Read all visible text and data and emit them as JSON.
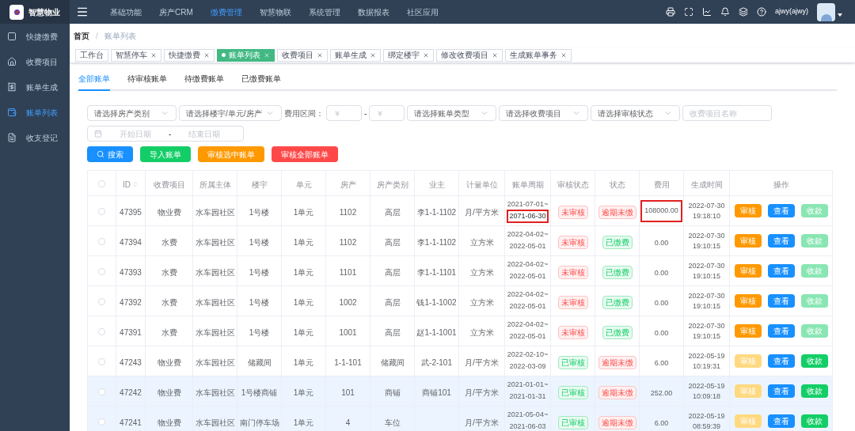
{
  "brand": {
    "name": "智慧物业"
  },
  "top_nav": [
    {
      "label": "基础功能",
      "selected": false
    },
    {
      "label": "房产CRM",
      "selected": false
    },
    {
      "label": "缴费管理",
      "selected": true
    },
    {
      "label": "智慧物联",
      "selected": false
    },
    {
      "label": "系统管理",
      "selected": false
    },
    {
      "label": "数据报表",
      "selected": false
    },
    {
      "label": "社区应用",
      "selected": false
    }
  ],
  "user": {
    "name": "ajwy(ajwy)"
  },
  "sidebar": {
    "items": [
      {
        "label": "快捷缴费",
        "selected": false
      },
      {
        "label": "收费项目",
        "selected": false
      },
      {
        "label": "账单生成",
        "selected": false
      },
      {
        "label": "账单列表",
        "selected": true
      },
      {
        "label": "收支登记",
        "selected": false
      }
    ]
  },
  "breadcrumb": {
    "items": [
      "首页",
      "账单列表"
    ],
    "separator": "/"
  },
  "page_tags": [
    {
      "label": "工作台",
      "closable": false,
      "selected": false
    },
    {
      "label": "智慧停车",
      "closable": true,
      "selected": false
    },
    {
      "label": "快捷缴费",
      "closable": true,
      "selected": false
    },
    {
      "label": "账单列表",
      "closable": true,
      "selected": true
    },
    {
      "label": "收费项目",
      "closable": true,
      "selected": false
    },
    {
      "label": "账单生成",
      "closable": true,
      "selected": false
    },
    {
      "label": "绑定楼宇",
      "closable": true,
      "selected": false
    },
    {
      "label": "修改收费项目",
      "closable": true,
      "selected": false
    },
    {
      "label": "生成账单事务",
      "closable": true,
      "selected": false
    }
  ],
  "tabs": [
    {
      "label": "全部账单",
      "selected": true
    },
    {
      "label": "待审核账单",
      "selected": false
    },
    {
      "label": "待缴费账单",
      "selected": false
    },
    {
      "label": "已缴费账单",
      "selected": false
    }
  ],
  "filters": {
    "property_type": {
      "placeholder": "请选择房产类别"
    },
    "building": {
      "placeholder": "请选择楼宇/单元/房产"
    },
    "fee_range_label": "费用区间：",
    "fee_min": {
      "placeholder": "￥"
    },
    "range_separator": "-",
    "fee_max": {
      "placeholder": "￥"
    },
    "bill_type": {
      "placeholder": "请选择账单类型"
    },
    "fee_item": {
      "placeholder": "请选择收费项目"
    },
    "audit_status": {
      "placeholder": "请选择审核状态"
    },
    "item_name": {
      "placeholder": "收费项目名称"
    },
    "start_date": {
      "placeholder": "开始日期"
    },
    "date_separator": "-",
    "end_date": {
      "placeholder": "结束日期"
    }
  },
  "actions": [
    {
      "label": "搜索",
      "kind": "search"
    },
    {
      "label": "导入账单",
      "kind": "import"
    },
    {
      "label": "审核选中账单",
      "kind": "audit_selected"
    },
    {
      "label": "审核全部账单",
      "kind": "audit_all"
    }
  ],
  "table": {
    "columns": [
      "ID",
      "收费项目",
      "所属主体",
      "楼宇",
      "单元",
      "房产",
      "房产类别",
      "业主",
      "计量单位",
      "账单周期",
      "审核状态",
      "状态",
      "费用",
      "生成时间",
      "操作"
    ],
    "select_all_checked": false,
    "rows": [
      {
        "checked": false,
        "id": "47395",
        "item": "物业费",
        "entity": "水车园社区",
        "building": "1号楼",
        "unit": "1单元",
        "house": "1102",
        "house_type": "高层",
        "owner": "李1-1-1102",
        "measure": "月/平方米",
        "period_start": "2021-07-01~",
        "period_end": "2071-06-30",
        "period_flagged": true,
        "audit": {
          "label": "未审核",
          "kind": "pending"
        },
        "status": {
          "label": "逾期未缴",
          "kind": "overdue"
        },
        "fee": "108000.00",
        "fee_flagged": true,
        "created_date": "2022-07-30",
        "created_time": "19:18:10",
        "buttons": [
          {
            "label": "审核",
            "kind": "audit",
            "enabled": true
          },
          {
            "label": "查看",
            "kind": "view",
            "enabled": true
          },
          {
            "label": "收款",
            "kind": "collect",
            "enabled": false
          }
        ],
        "highlighted": false
      },
      {
        "checked": false,
        "id": "47394",
        "item": "水费",
        "entity": "水车园社区",
        "building": "1号楼",
        "unit": "1单元",
        "house": "1102",
        "house_type": "高层",
        "owner": "李1-1-1102",
        "measure": "立方米",
        "period_start": "2022-04-02~",
        "period_end": "2022-05-01",
        "period_flagged": false,
        "audit": {
          "label": "未审核",
          "kind": "pending"
        },
        "status": {
          "label": "已缴费",
          "kind": "paid"
        },
        "fee": "0.00",
        "fee_flagged": false,
        "created_date": "2022-07-30",
        "created_time": "19:10:15",
        "buttons": [
          {
            "label": "审核",
            "kind": "audit",
            "enabled": true
          },
          {
            "label": "查看",
            "kind": "view",
            "enabled": true
          },
          {
            "label": "收款",
            "kind": "collect",
            "enabled": false
          }
        ],
        "highlighted": false
      },
      {
        "checked": false,
        "id": "47393",
        "item": "水费",
        "entity": "水车园社区",
        "building": "1号楼",
        "unit": "1单元",
        "house": "1101",
        "house_type": "高层",
        "owner": "李1-1-1101",
        "measure": "立方米",
        "period_start": "2022-04-02~",
        "period_end": "2022-05-01",
        "period_flagged": false,
        "audit": {
          "label": "未审核",
          "kind": "pending"
        },
        "status": {
          "label": "已缴费",
          "kind": "paid"
        },
        "fee": "0.00",
        "fee_flagged": false,
        "created_date": "2022-07-30",
        "created_time": "19:10:15",
        "buttons": [
          {
            "label": "审核",
            "kind": "audit",
            "enabled": true
          },
          {
            "label": "查看",
            "kind": "view",
            "enabled": true
          },
          {
            "label": "收款",
            "kind": "collect",
            "enabled": false
          }
        ],
        "highlighted": false
      },
      {
        "checked": false,
        "id": "47392",
        "item": "水费",
        "entity": "水车园社区",
        "building": "1号楼",
        "unit": "1单元",
        "house": "1002",
        "house_type": "高层",
        "owner": "钱1-1-1002",
        "measure": "立方米",
        "period_start": "2022-04-02~",
        "period_end": "2022-05-01",
        "period_flagged": false,
        "audit": {
          "label": "未审核",
          "kind": "pending"
        },
        "status": {
          "label": "已缴费",
          "kind": "paid"
        },
        "fee": "0.00",
        "fee_flagged": false,
        "created_date": "2022-07-30",
        "created_time": "19:10:15",
        "buttons": [
          {
            "label": "审核",
            "kind": "audit",
            "enabled": true
          },
          {
            "label": "查看",
            "kind": "view",
            "enabled": true
          },
          {
            "label": "收款",
            "kind": "collect",
            "enabled": false
          }
        ],
        "highlighted": false
      },
      {
        "checked": false,
        "id": "47391",
        "item": "水费",
        "entity": "水车园社区",
        "building": "1号楼",
        "unit": "1单元",
        "house": "1001",
        "house_type": "高层",
        "owner": "赵1-1-1001",
        "measure": "立方米",
        "period_start": "2022-04-02~",
        "period_end": "2022-05-01",
        "period_flagged": false,
        "audit": {
          "label": "未审核",
          "kind": "pending"
        },
        "status": {
          "label": "已缴费",
          "kind": "paid"
        },
        "fee": "0.00",
        "fee_flagged": false,
        "created_date": "2022-07-30",
        "created_time": "19:10:15",
        "buttons": [
          {
            "label": "审核",
            "kind": "audit",
            "enabled": true
          },
          {
            "label": "查看",
            "kind": "view",
            "enabled": true
          },
          {
            "label": "收款",
            "kind": "collect",
            "enabled": false
          }
        ],
        "highlighted": false
      },
      {
        "checked": false,
        "id": "47243",
        "item": "物业费",
        "entity": "水车园社区",
        "building": "储藏间",
        "unit": "1单元",
        "house": "1-1-101",
        "house_type": "储藏间",
        "owner": "武-2-101",
        "measure": "月/平方米",
        "period_start": "2022-02-10~",
        "period_end": "2022-03-09",
        "period_flagged": false,
        "audit": {
          "label": "已审核",
          "kind": "approved"
        },
        "status": {
          "label": "逾期未缴",
          "kind": "overdue"
        },
        "fee": "6.00",
        "fee_flagged": false,
        "created_date": "2022-05-19",
        "created_time": "10:19:31",
        "buttons": [
          {
            "label": "审核",
            "kind": "audit",
            "enabled": false
          },
          {
            "label": "查看",
            "kind": "view",
            "enabled": true
          },
          {
            "label": "收款",
            "kind": "collect",
            "enabled": true
          }
        ],
        "highlighted": false
      },
      {
        "checked": false,
        "id": "47242",
        "item": "物业费",
        "entity": "水车园社区",
        "building": "1号楼商铺",
        "unit": "1单元",
        "house": "101",
        "house_type": "商铺",
        "owner": "商铺101",
        "measure": "月/平方米",
        "period_start": "2021-01-01~",
        "period_end": "2021-01-31",
        "period_flagged": false,
        "audit": {
          "label": "已审核",
          "kind": "approved"
        },
        "status": {
          "label": "逾期未缴",
          "kind": "overdue"
        },
        "fee": "252.00",
        "fee_flagged": false,
        "created_date": "2022-05-19",
        "created_time": "10:09:18",
        "buttons": [
          {
            "label": "审核",
            "kind": "audit",
            "enabled": false
          },
          {
            "label": "查看",
            "kind": "view",
            "enabled": true
          },
          {
            "label": "收款",
            "kind": "collect",
            "enabled": true
          }
        ],
        "highlighted": true
      },
      {
        "checked": false,
        "id": "47241",
        "item": "物业费",
        "entity": "水车园社区",
        "building": "南门停车场",
        "unit": "1单元",
        "house": "4",
        "house_type": "车位",
        "measure": "月/平方米",
        "period_start": "2021-05-04~",
        "period_end": "2021-06-03",
        "period_flagged": false,
        "audit": {
          "label": "已审核",
          "kind": "approved"
        },
        "status": {
          "label": "逾期未缴",
          "kind": "overdue"
        },
        "fee": "6.00",
        "fee_flagged": false,
        "created_date": "2022-05-19",
        "created_time": "08:59:39",
        "buttons": [
          {
            "label": "审核",
            "kind": "audit",
            "enabled": false
          },
          {
            "label": "查看",
            "kind": "view",
            "enabled": true
          },
          {
            "label": "收款",
            "kind": "collect",
            "enabled": true
          }
        ],
        "highlighted": true
      }
    ]
  }
}
